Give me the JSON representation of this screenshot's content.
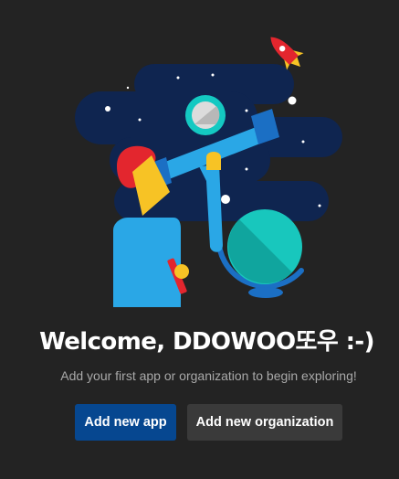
{
  "welcome": {
    "title": "Welcome, DDOWOO또우 :-)",
    "subtitle": "Add your first app or organization to begin exploring!"
  },
  "actions": {
    "add_app_label": "Add new app",
    "add_org_label": "Add new organization"
  },
  "colors": {
    "background": "#232323",
    "primary_button": "#064790",
    "secondary_button": "#3a3a3a",
    "subtitle_text": "#a9a9a9",
    "space_navy": "#0f2550"
  },
  "illustration": {
    "icons": [
      "rocket-icon",
      "telescope-icon",
      "globe-icon",
      "moon-icon",
      "astronaut-icon"
    ]
  }
}
